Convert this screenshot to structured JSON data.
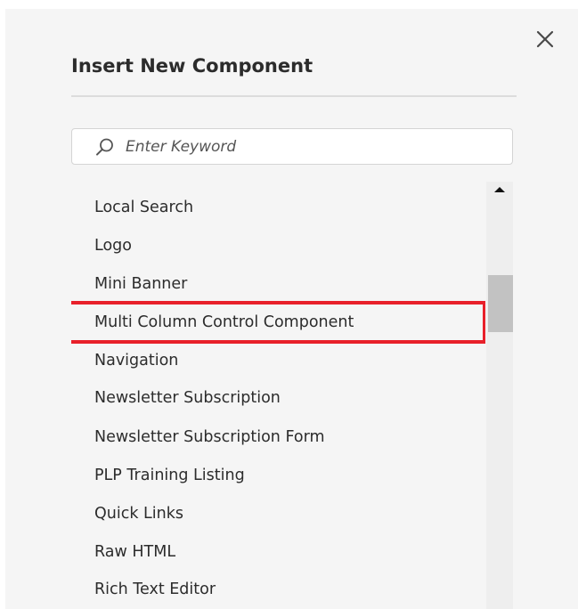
{
  "dialog": {
    "title": "Insert New Component",
    "close_icon": "close-icon",
    "search": {
      "placeholder": "Enter Keyword",
      "value": "",
      "icon": "search-icon"
    },
    "components": [
      "Local Search",
      "Logo",
      "Mini Banner",
      "Multi Column Control Component",
      "Navigation",
      "Newsletter Subscription",
      "Newsletter Subscription Form",
      "PLP Training Listing",
      "Quick Links",
      "Raw HTML",
      "Rich Text Editor"
    ],
    "highlighted_component": "Multi Column Control Component",
    "highlight_color": "#e8202a"
  }
}
